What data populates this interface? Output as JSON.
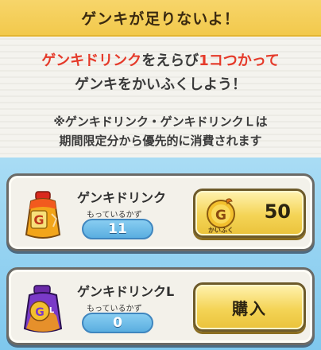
{
  "header": {
    "title": "ゲンキが足りないよ！"
  },
  "message": {
    "line1_red_a": "ゲンキドリンク",
    "line1_black_a": "をえらび",
    "line1_red_b": "1コつかって",
    "line2": "ゲンキをかいふくしよう！",
    "note_line1": "※ゲンキドリンク・ゲンキドリンクＬは",
    "note_line2": "期間限定分から優先的に消費されます"
  },
  "items": [
    {
      "name": "ゲンキドリンク",
      "own_label": "もっているかず",
      "count": "11",
      "icon_letter": "G",
      "action": {
        "type": "use",
        "coin_letter": "G",
        "sub_label": "かいふく",
        "cost": "50"
      }
    },
    {
      "name": "ゲンキドリンクL",
      "own_label": "もっているかず",
      "count": "0",
      "icon_letter": "G",
      "icon_sub": "L",
      "action": {
        "type": "buy",
        "label": "購入"
      }
    }
  ],
  "colors": {
    "header_bg": "#f2c94c",
    "accent_red": "#e53a2a",
    "button_gold": "#f4d456",
    "count_blue": "#5aaee0"
  }
}
